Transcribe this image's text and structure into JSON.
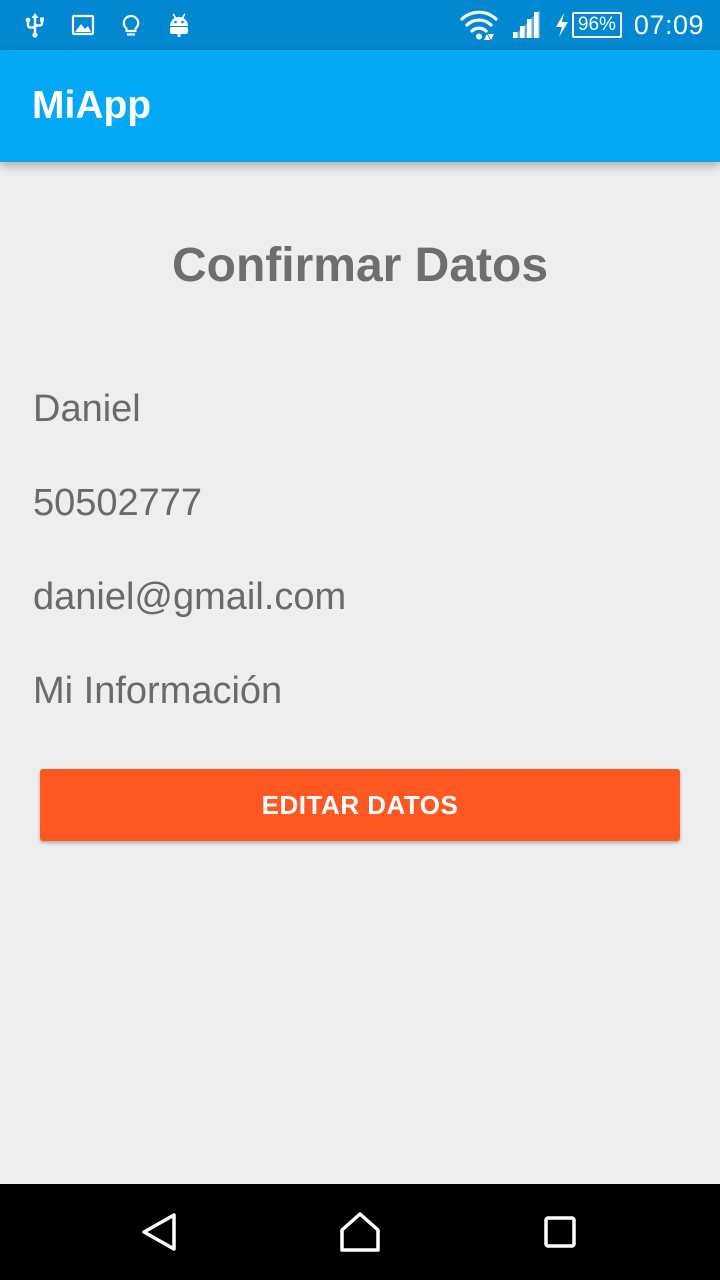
{
  "status_bar": {
    "icons_left": [
      "usb-icon",
      "image-icon",
      "lightbulb-icon",
      "android-icon"
    ],
    "icons_right": [
      "wifi-icon",
      "signal-icon",
      "charging-icon",
      "battery-icon"
    ],
    "battery_percent": "96%",
    "time": "07:09",
    "background_color": "#0288d1"
  },
  "app_bar": {
    "title": "MiApp",
    "background_color": "#03a9f4"
  },
  "main": {
    "heading": "Confirmar Datos",
    "name": "Daniel",
    "phone": "50502777",
    "email": "daniel@gmail.com",
    "info": "Mi Información",
    "edit_button_label": "EDITAR DATOS",
    "edit_button_color": "#ff5722",
    "background_color": "#eeeeee"
  },
  "nav_bar": {
    "buttons": [
      "back-icon",
      "home-icon",
      "recent-apps-icon"
    ]
  }
}
